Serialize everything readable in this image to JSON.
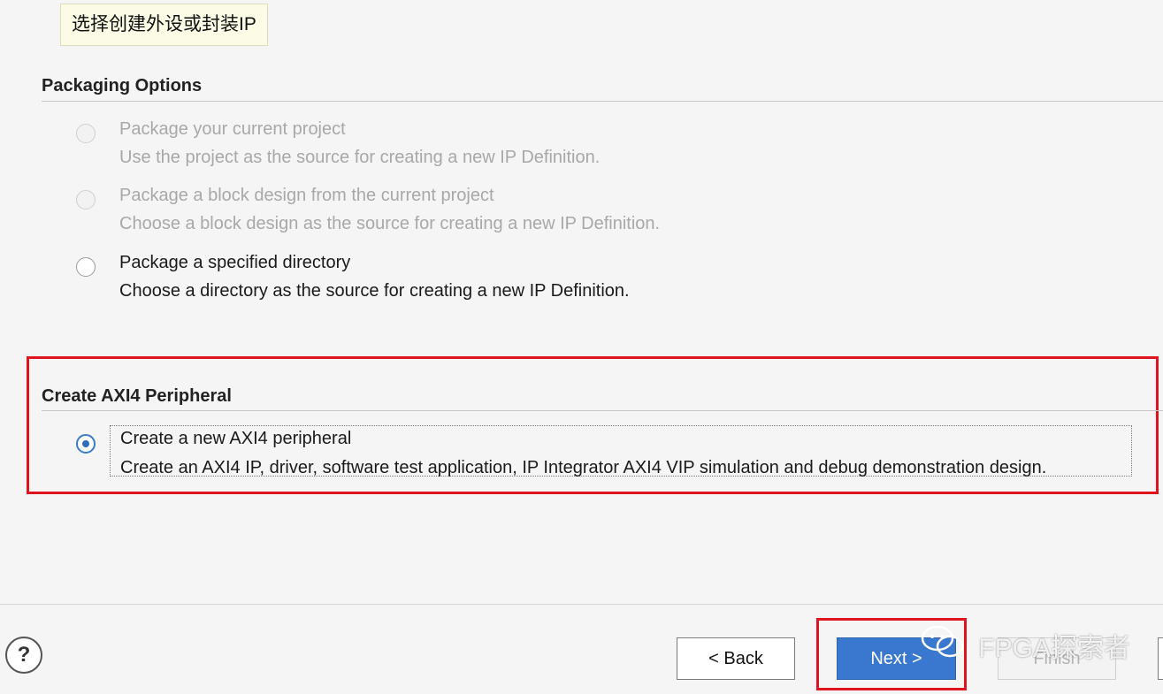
{
  "tooltip": {
    "text": "选择创建外设或封装IP"
  },
  "packaging": {
    "title": "Packaging Options",
    "options": [
      {
        "label": "Package your current project",
        "desc": "Use the project as the source for creating a new IP Definition.",
        "enabled": false,
        "selected": false
      },
      {
        "label": "Package a block design from the current project",
        "desc": "Choose a block design as the source for creating a new IP Definition.",
        "enabled": false,
        "selected": false
      },
      {
        "label": "Package a specified directory",
        "desc": "Choose a directory as the source for creating a new IP Definition.",
        "enabled": true,
        "selected": false
      }
    ]
  },
  "axi": {
    "title": "Create AXI4 Peripheral",
    "option": {
      "label": "Create a new AXI4 peripheral",
      "desc": "Create an AXI4 IP, driver, software test application, IP Integrator AXI4 VIP simulation and debug demonstration design.",
      "enabled": true,
      "selected": true
    }
  },
  "footer": {
    "help_label": "?",
    "back_label": "< Back",
    "next_label": "Next >",
    "finish_label": "Finish",
    "finish_enabled": false
  },
  "watermark": {
    "text": "FPGA探索者"
  },
  "colors": {
    "highlight_red": "#e0141e",
    "primary_blue": "#3a78cf",
    "radio_blue": "#2e6fba"
  },
  "icons": {
    "help": "question-mark-icon",
    "watermark": "wechat-icon"
  }
}
